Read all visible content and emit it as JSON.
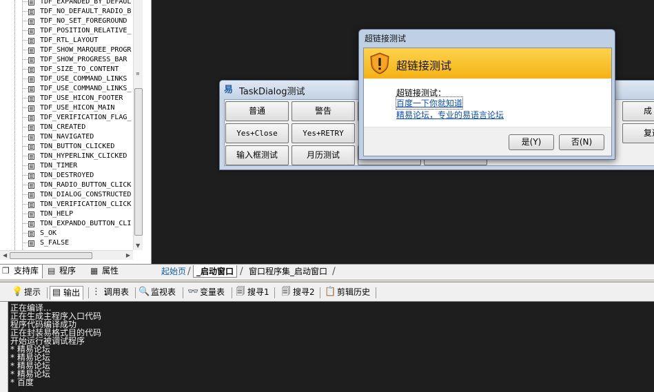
{
  "tree": {
    "items": [
      "TDF_EXPANDED_BY_DEFAUL",
      "TDF_NO_DEFAULT_RADIO_B",
      "TDF_NO_SET_FOREGROUND",
      "TDF_POSITION_RELATIVE_",
      "TDF_RTL_LAYOUT",
      "TDF_SHOW_MARQUEE_PROGR",
      "TDF_SHOW_PROGRESS_BAR",
      "TDF_SIZE_TO_CONTENT",
      "TDF_USE_COMMAND_LINKS",
      "TDF_USE_COMMAND_LINKS_",
      "TDF_USE_HICON_FOOTER",
      "TDF_USE_HICON_MAIN",
      "TDF_VERIFICATION_FLAG_",
      "TDN_CREATED",
      "TDN_NAVIGATED",
      "TDN_BUTTON_CLICKED",
      "TDN_HYPERLINK_CLICKED",
      "TDN_TIMER",
      "TDN_DESTROYED",
      "TDN_RADIO_BUTTON_CLICK",
      "TDN_DIALOG_CONSTRUCTED",
      "TDN_VERIFICATION_CLICK",
      "TDN_HELP",
      "TDN_EXPANDO_BUTTON_CLI",
      "S_OK",
      "S_FALSE"
    ]
  },
  "left_tabs": {
    "support": "支持库",
    "program": "程序",
    "properties": "属性"
  },
  "editor_tabs": [
    "起始页",
    "_启动窗口",
    "窗口程序集_启动窗口"
  ],
  "bottom_tabs": [
    "提示",
    "输出",
    "调用表",
    "监视表",
    "变量表",
    "搜寻1",
    "搜寻2",
    "剪辑历史"
  ],
  "output_lines": [
    "正在编译...",
    "正在生成主程序入口代码",
    "程序代码编译成功",
    "正在封装易格式目的代码",
    "开始运行被调试程序",
    "* 精易论坛",
    "* 精易论坛",
    "* 精易论坛",
    "* 精易论坛",
    "* 百度"
  ],
  "taskdialog": {
    "title": "TaskDialog测试",
    "buttons_row1": [
      "普通",
      "警告",
      "",
      "",
      "",
      "成"
    ],
    "buttons_row2": [
      "Yes+Close",
      "Yes+RETRY",
      "",
      "",
      "",
      "复选"
    ],
    "buttons_row3": [
      "输入框测试",
      "月历测试",
      "",
      ""
    ]
  },
  "link_dialog": {
    "title": "超链接测试",
    "header": "超链接测试",
    "content_label": "超链接测试：",
    "link1": "百度一下你就知道",
    "link2": "精易论坛，专业的易语言论坛",
    "yes": "是(Y)",
    "no": "否(N)"
  },
  "colors": {
    "banner": "#f4b214",
    "link": "#0a4ec0",
    "background": "#1e1e1e"
  }
}
